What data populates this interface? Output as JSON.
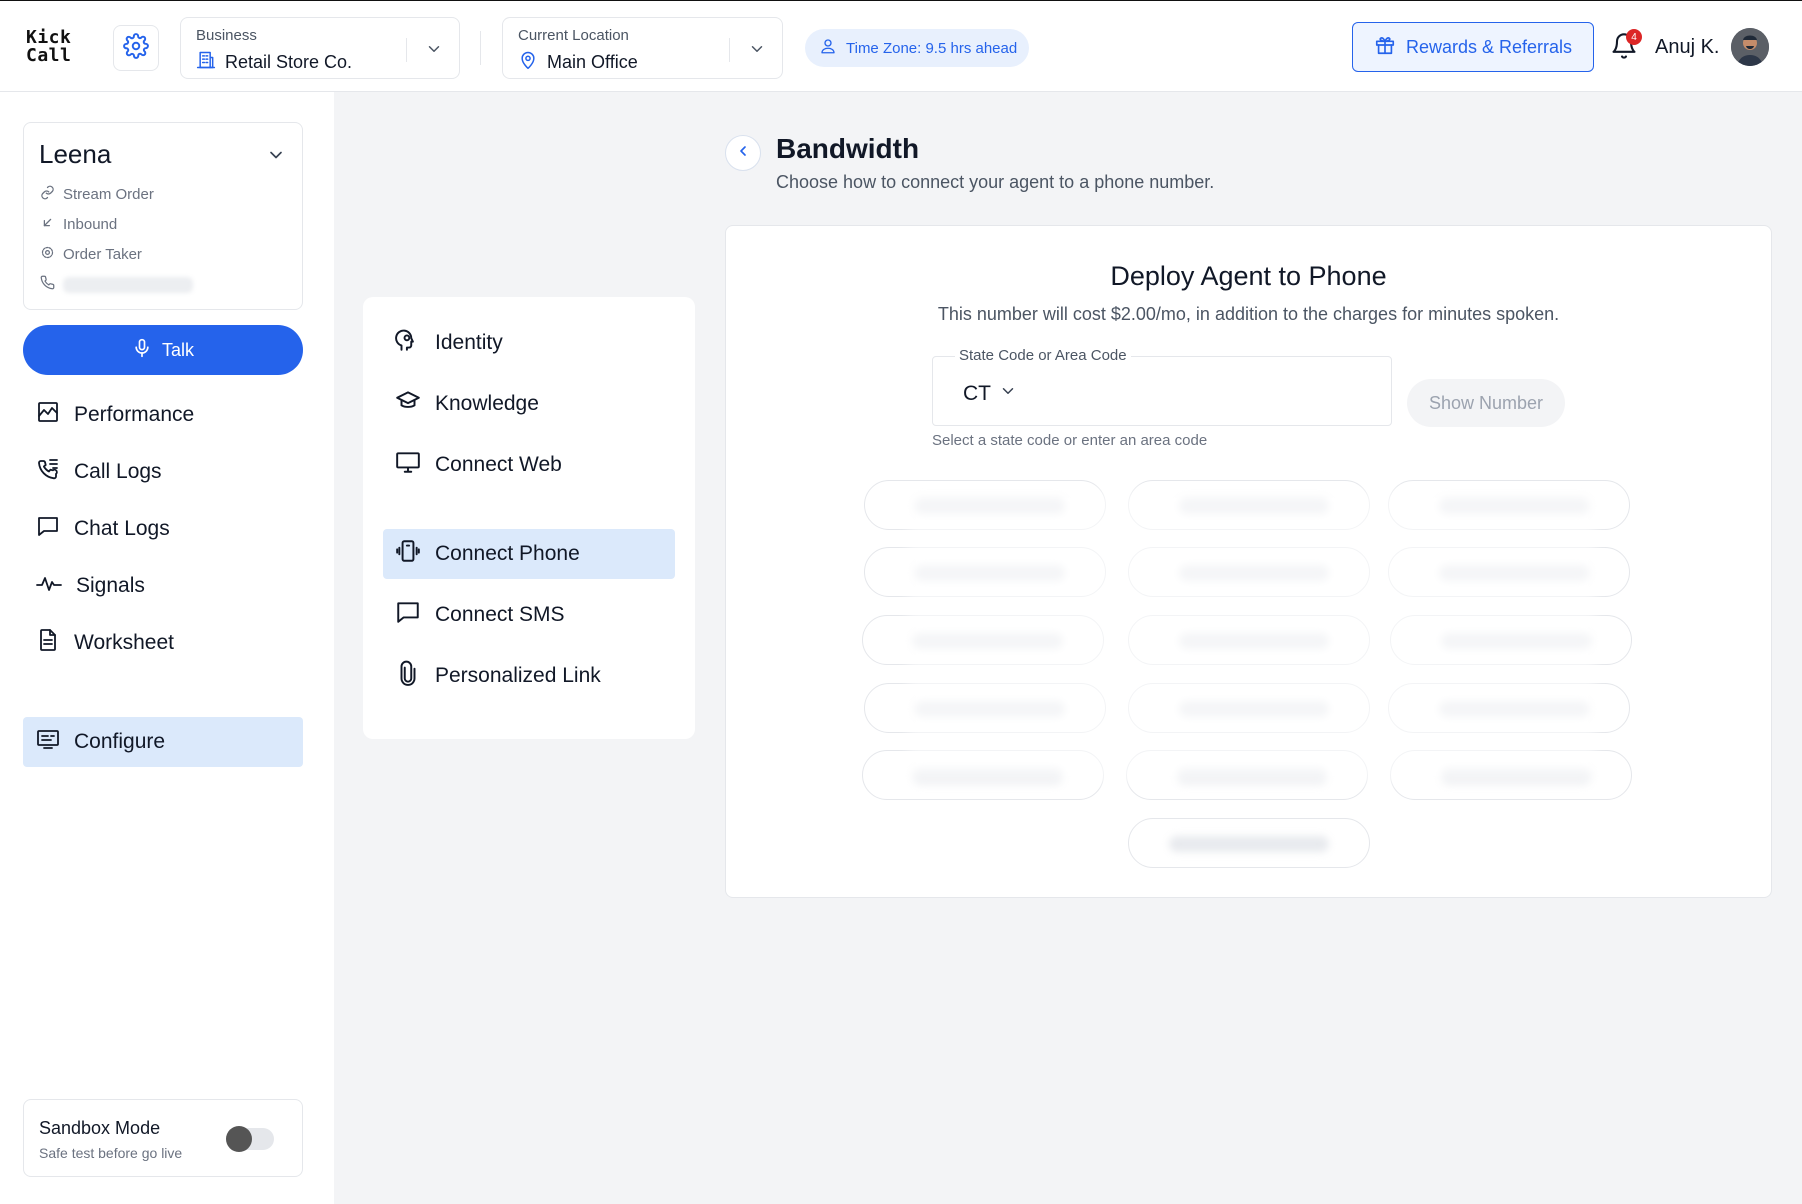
{
  "app": {
    "logo_line1": "Kick",
    "logo_line2": "Call"
  },
  "header": {
    "business": {
      "label": "Business",
      "value": "Retail Store Co."
    },
    "location": {
      "label": "Current Location",
      "value": "Main Office"
    },
    "timezone": "Time Zone: 9.5 hrs ahead",
    "rewards_label": "Rewards & Referrals",
    "notification_count": "4",
    "user_name": "Anuj K."
  },
  "agent": {
    "name": "Leena",
    "details": [
      {
        "icon": "link-icon",
        "text": "Stream Order"
      },
      {
        "icon": "inbound-arrow-icon",
        "text": "Inbound"
      },
      {
        "icon": "settings-icon",
        "text": "Order Taker"
      }
    ]
  },
  "sidebar": {
    "talk_label": "Talk",
    "items": [
      {
        "icon": "chart-icon",
        "label": "Performance",
        "active": false
      },
      {
        "icon": "phone-list-icon",
        "label": "Call Logs",
        "active": false
      },
      {
        "icon": "chat-icon",
        "label": "Chat Logs",
        "active": false
      },
      {
        "icon": "pulse-icon",
        "label": "Signals",
        "active": false
      },
      {
        "icon": "document-icon",
        "label": "Worksheet",
        "active": false
      },
      {
        "icon": "configure-icon",
        "label": "Configure",
        "active": true
      }
    ],
    "sandbox": {
      "title": "Sandbox Mode",
      "subtitle": "Safe test before go live",
      "enabled": false
    }
  },
  "config_menu": {
    "items": [
      {
        "icon": "identity-icon",
        "label": "Identity",
        "active": false
      },
      {
        "icon": "graduation-cap-icon",
        "label": "Knowledge",
        "active": false
      },
      {
        "icon": "monitor-icon",
        "label": "Connect Web",
        "active": false
      },
      {
        "icon": "phone-vibrate-icon",
        "label": "Connect Phone",
        "active": true
      },
      {
        "icon": "message-icon",
        "label": "Connect SMS",
        "active": false
      },
      {
        "icon": "paperclip-icon",
        "label": "Personalized Link",
        "active": false
      }
    ]
  },
  "main": {
    "title": "Bandwidth",
    "subtitle": "Choose how to connect your agent to a phone number.",
    "card": {
      "title": "Deploy Agent to Phone",
      "subtitle": "This number will cost $2.00/mo, in addition to the charges for minutes spoken.",
      "field_label": "State Code or Area Code",
      "field_value": "CT",
      "field_help": "Select a state code or enter an area code",
      "show_button": "Show Number"
    }
  },
  "colors": {
    "accent": "#2563eb",
    "active_bg": "#dbe9fb",
    "badge": "#dc2626"
  }
}
